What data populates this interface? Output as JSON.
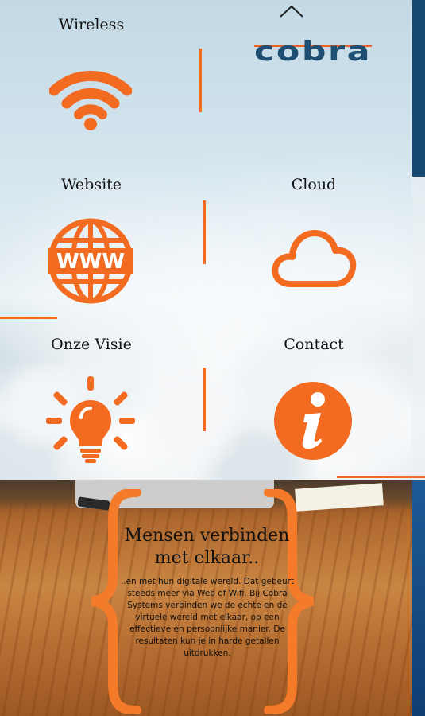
{
  "tiles": {
    "wireless": "Wireless",
    "website": "Website",
    "cloud": "Cloud",
    "vision": "Onze Visie",
    "contact": "Contact"
  },
  "logo": {
    "text": "cobra"
  },
  "quote": {
    "title": "Mensen verbinden met elkaar..",
    "body": "..en met hun digitale wereld. Dat gebeurt steeds meer via Web of Wifi. Bij Cobra Systems verbinden we de echte en de virtuele wereld met elkaar, op een effectieve en persoonlijke manier. De resultaten kun je in harde getallen uitdrukken."
  },
  "colors": {
    "accent": "#f26b21",
    "logo_blue": "#1f4e73",
    "logo_orange": "#e8632a"
  },
  "icons": [
    "chevron-up-icon",
    "wifi-icon",
    "www-globe-icon",
    "cloud-icon",
    "lightbulb-icon",
    "info-icon"
  ]
}
